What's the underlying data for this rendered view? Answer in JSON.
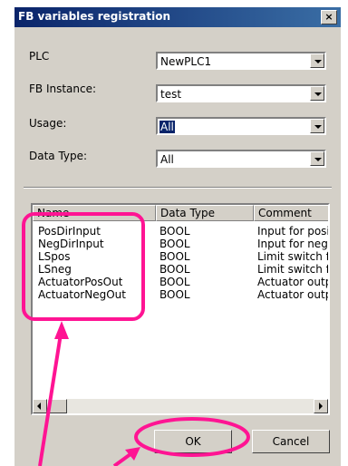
{
  "dialog": {
    "title": "FB variables registration",
    "close_label": "×"
  },
  "fields": [
    {
      "label": "PLC",
      "value": "NewPLC1",
      "selected": false
    },
    {
      "label": "FB Instance:",
      "value": "test",
      "selected": false
    },
    {
      "label": "Usage:",
      "value": "All",
      "selected": true
    },
    {
      "label": "Data Type:",
      "value": "All",
      "selected": false
    }
  ],
  "list": {
    "columns": [
      "Name",
      "Data Type",
      "Comment"
    ],
    "rows": [
      {
        "name": "PosDirInput",
        "type": "BOOL",
        "comment": "Input for positi"
      },
      {
        "name": "NegDirInput",
        "type": "BOOL",
        "comment": "Input for nega"
      },
      {
        "name": "LSpos",
        "type": "BOOL",
        "comment": "Limit switch fo"
      },
      {
        "name": "LSneg",
        "type": "BOOL",
        "comment": "Limit switch fo"
      },
      {
        "name": "ActuatorPosOut",
        "type": "BOOL",
        "comment": "Actuator outpu"
      },
      {
        "name": "ActuatorNegOut",
        "type": "BOOL",
        "comment": "Actuator outpu"
      }
    ]
  },
  "buttons": {
    "ok": "OK",
    "cancel": "Cancel"
  },
  "annotation_color": "#ff1493"
}
